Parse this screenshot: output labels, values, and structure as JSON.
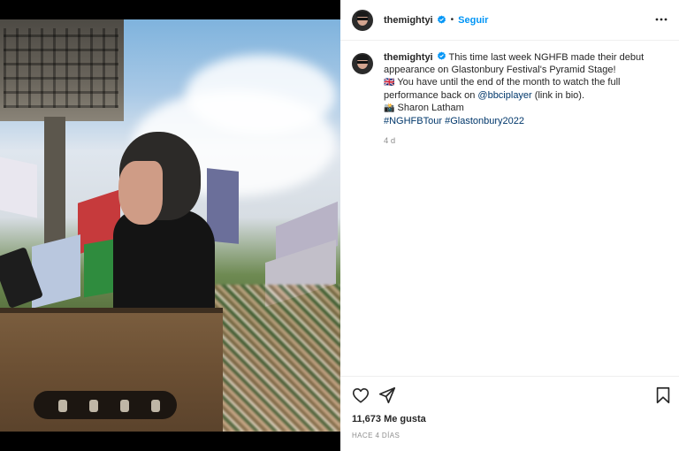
{
  "post": {
    "username": "themightyi",
    "follow_label": "Seguir",
    "separator": "•",
    "caption": {
      "username": "themightyi",
      "line1": "This time last week NGHFB made their debut appearance on Glastonbury Festival's Pyramid Stage!",
      "flag_emoji": "🇬🇧",
      "line2_pre": "You have until the end of the month to watch the full performance back on",
      "mention": "@bbciplayer",
      "line2_post": "(link in bio).",
      "camera_emoji": "📸",
      "credit": "Sharon Latham",
      "hashtag1": "#NGHFBTour",
      "hashtag2": "#Glastonbury2022",
      "age": "4 d"
    },
    "likes": "11,673 Me gusta",
    "posted_ago": "HACE 4 DÍAS"
  },
  "colors": {
    "accent": "#0095f6",
    "link": "#00376b",
    "muted": "#8e8e8e",
    "text": "#262626"
  },
  "icons": [
    "verified-badge-icon",
    "more-options-icon",
    "heart-icon",
    "share-icon",
    "bookmark-icon"
  ]
}
